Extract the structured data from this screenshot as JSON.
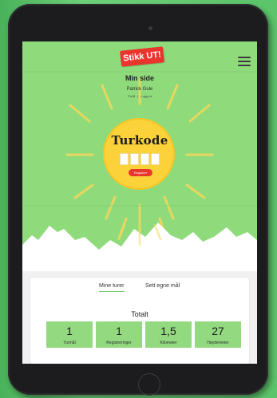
{
  "header": {
    "logo": "Stikk UT!",
    "menu_icon": "hamburger-menu-icon"
  },
  "profile": {
    "page_title": "Min side",
    "user_name": "Patrick Gule",
    "link_profile": "Profil",
    "link_separator": "|",
    "link_logout": "Logg ut"
  },
  "register": {
    "label": "Turkode",
    "code_slots": [
      "",
      "",
      "",
      ""
    ],
    "button_label": "Registrer"
  },
  "tabs": [
    {
      "label": "Mine turer",
      "active": true
    },
    {
      "label": "Sett egne mål",
      "active": false
    }
  ],
  "summary": {
    "title": "Totalt",
    "stats": [
      {
        "value": "1",
        "label": "Turmål"
      },
      {
        "value": "1",
        "label": "Registreringer"
      },
      {
        "value": "1,5",
        "label": "Kilometer"
      },
      {
        "value": "27",
        "label": "Høydemeter"
      }
    ]
  },
  "colors": {
    "background": "#8fdb7c",
    "sun": "#fcd23a",
    "accent_red": "#e8362e",
    "stat_box": "#92d97f"
  }
}
